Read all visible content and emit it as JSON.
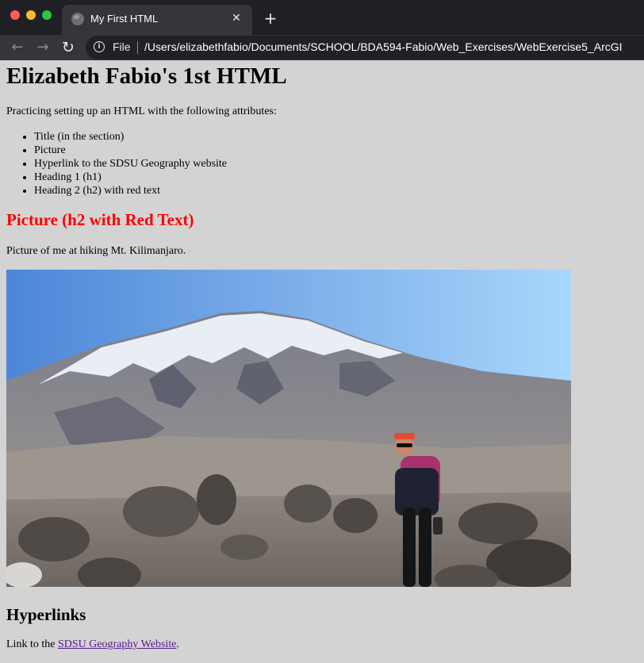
{
  "browser": {
    "tab_title": "My First HTML",
    "tab_close": "✕",
    "new_tab": "+",
    "scheme_label": "File",
    "url": "/Users/elizabethfabio/Documents/SCHOOL/BDA594-Fabio/Web_Exercises/WebExercise5_ArcGI"
  },
  "page": {
    "heading1": "Elizabeth Fabio's 1st HTML",
    "intro": "Practicing setting up an HTML with the following attributes:",
    "list": [
      "Title (in the section)",
      "Picture",
      "Hyperlink to the SDSU Geography website",
      "Heading 1 (h1)",
      "Heading 2 (h2) with red text"
    ],
    "picture_heading": "Picture (h2 with Red Text)",
    "picture_caption": "Picture of me at hiking Mt. Kilimanjaro.",
    "hyperlinks_heading": "Hyperlinks",
    "link_prefix": "Link to the ",
    "link_text": "SDSU Geography Website",
    "link_suffix": "."
  },
  "colors": {
    "page_background": "#d3d3d3",
    "red_heading": "#ff0000",
    "visited_link": "#551a8b"
  }
}
